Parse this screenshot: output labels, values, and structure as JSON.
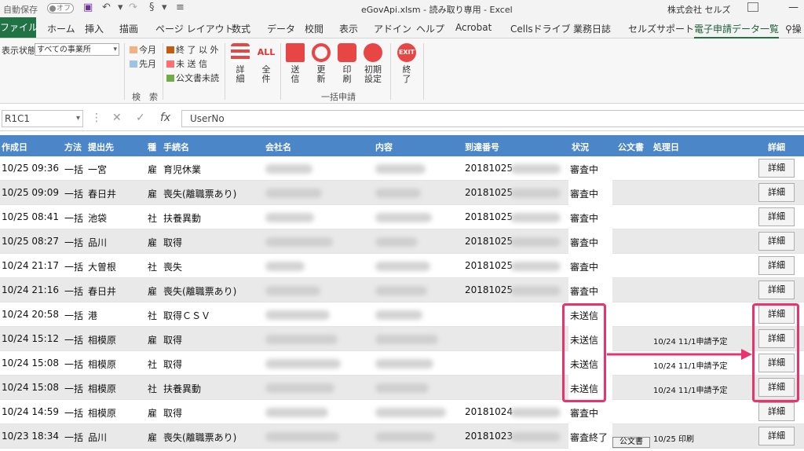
{
  "titlebar": {
    "autosave_label": "自動保存",
    "autosave_state": "オフ",
    "title": "eGovApi.xlsm  -  読み取り専用  -  Excel",
    "company": "株式会社 セルズ"
  },
  "tabs": [
    {
      "label": "ファイル"
    },
    {
      "label": "ホーム"
    },
    {
      "label": "挿入"
    },
    {
      "label": "描画"
    },
    {
      "label": "ページ レイアウト"
    },
    {
      "label": "数式"
    },
    {
      "label": "データ"
    },
    {
      "label": "校閲"
    },
    {
      "label": "表示"
    },
    {
      "label": "アドイン"
    },
    {
      "label": "ヘルプ"
    },
    {
      "label": "Acrobat"
    },
    {
      "label": "Cellsドライブ"
    },
    {
      "label": "業務日誌"
    },
    {
      "label": "セルズサポート"
    },
    {
      "label": "電子申請データ一覧"
    },
    {
      "label": "操"
    }
  ],
  "ribbon": {
    "display_state_label": "表示状態",
    "display_state_value": "すべての事業所",
    "this_month": "今月",
    "prev_month": "先月",
    "except_done": "終 了 以 外",
    "unsent": "未 送 信",
    "unread_docs": "公文書未読",
    "detail_line1": "詳",
    "detail_line2": "細",
    "all_line1": "全",
    "all_line2": "件",
    "all_icon_text": "ALL",
    "send_line1": "送",
    "send_line2": "信",
    "update_line1": "更",
    "update_line2": "新",
    "print_line1": "印",
    "print_line2": "刷",
    "init_line1": "初期",
    "init_line2": "設定",
    "exit_line1": "終",
    "exit_line2": "了",
    "exit_icon_text": "EXIT",
    "group_search": "検　索",
    "group_bulk": "一括申請"
  },
  "formula_bar": {
    "name_box": "R1C1",
    "fx": "fx",
    "formula": "UserNo"
  },
  "table": {
    "headers": {
      "created": "作成日",
      "method": "方法",
      "dest": "提出先",
      "kind": "種",
      "procedure": "手続名",
      "company": "会社名",
      "content": "内容",
      "arrival": "到達番号",
      "status": "状況",
      "doc": "公文書",
      "process_date": "処理日",
      "detail": "詳細"
    },
    "rows": [
      {
        "created": "10/25 09:36",
        "method": "一括",
        "dest": "一宮",
        "kind": "雇",
        "procedure": "育児休業",
        "arrival": "20181025",
        "status": "審査中",
        "process": "",
        "detail": "詳細"
      },
      {
        "created": "10/25 09:09",
        "method": "一括",
        "dest": "春日井",
        "kind": "雇",
        "procedure": "喪失(離職票あり)",
        "arrival": "20181025",
        "status": "審査中",
        "process": "",
        "detail": "詳細"
      },
      {
        "created": "10/25 08:41",
        "method": "一括",
        "dest": "池袋",
        "kind": "社",
        "procedure": "扶養異動",
        "arrival": "20181025",
        "status": "審査中",
        "process": "",
        "detail": "詳細"
      },
      {
        "created": "10/25 08:27",
        "method": "一括",
        "dest": "品川",
        "kind": "雇",
        "procedure": "取得",
        "arrival": "20181025",
        "status": "審査中",
        "process": "",
        "detail": "詳細"
      },
      {
        "created": "10/24 21:17",
        "method": "一括",
        "dest": "大曽根",
        "kind": "社",
        "procedure": "喪失",
        "arrival": "20181025",
        "status": "審査中",
        "process": "",
        "detail": "詳細"
      },
      {
        "created": "10/24 21:16",
        "method": "一括",
        "dest": "春日井",
        "kind": "雇",
        "procedure": "喪失(離職票あり)",
        "arrival": "20181025",
        "status": "審査中",
        "process": "",
        "detail": "詳細"
      },
      {
        "created": "10/24 20:58",
        "method": "一括",
        "dest": "港",
        "kind": "社",
        "procedure": "取得ＣＳＶ",
        "arrival": "",
        "status": "未送信",
        "process": "",
        "detail": "詳細"
      },
      {
        "created": "10/24 15:12",
        "method": "一括",
        "dest": "相模原",
        "kind": "雇",
        "procedure": "取得",
        "arrival": "",
        "status": "未送信",
        "process": "10/24 11/1申請予定",
        "detail": "詳細"
      },
      {
        "created": "10/24 15:08",
        "method": "一括",
        "dest": "相模原",
        "kind": "社",
        "procedure": "取得",
        "arrival": "",
        "status": "未送信",
        "process": "10/24 11/1申請予定",
        "detail": "詳細"
      },
      {
        "created": "10/24 15:08",
        "method": "一括",
        "dest": "相模原",
        "kind": "社",
        "procedure": "扶養異動",
        "arrival": "",
        "status": "未送信",
        "process": "10/24 11/1申請予定",
        "detail": "詳細"
      },
      {
        "created": "10/24 14:59",
        "method": "一括",
        "dest": "相模原",
        "kind": "雇",
        "procedure": "取得",
        "arrival": "20181024",
        "status": "審査中",
        "process": "",
        "detail": "詳細"
      },
      {
        "created": "10/23 18:34",
        "method": "一括",
        "dest": "品川",
        "kind": "雇",
        "procedure": "喪失(離職票あり)",
        "arrival": "20181023",
        "status": "審査終了",
        "process": "10/25 印刷",
        "doc_button": "公文書",
        "detail": "詳細"
      }
    ]
  },
  "colors": {
    "header_bg": "#4a86c8",
    "file_tab": "#217346",
    "highlight": "#e8336c"
  }
}
